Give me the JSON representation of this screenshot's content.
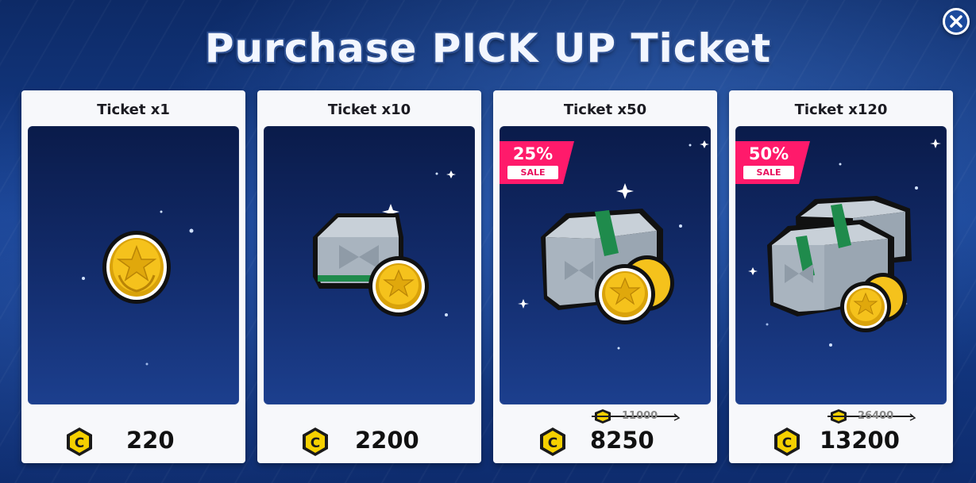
{
  "title": "Purchase PICK UP Ticket",
  "close_icon": "close-icon",
  "currency_icon": "c-coin-icon",
  "colors": {
    "sale_badge": "#ff1a6b",
    "card_bg": "#f7f8fb",
    "art_bg": "#132d6e",
    "currency": "#f5d000"
  },
  "cards": [
    {
      "label": "Ticket x1",
      "price": "220",
      "sale": null,
      "original_price": null
    },
    {
      "label": "Ticket x10",
      "price": "2200",
      "sale": null,
      "original_price": null
    },
    {
      "label": "Ticket x50",
      "price": "8250",
      "sale": {
        "percent": "25%",
        "label": "SALE"
      },
      "original_price": "11000"
    },
    {
      "label": "Ticket x120",
      "price": "13200",
      "sale": {
        "percent": "50%",
        "label": "SALE"
      },
      "original_price": "26400"
    }
  ]
}
